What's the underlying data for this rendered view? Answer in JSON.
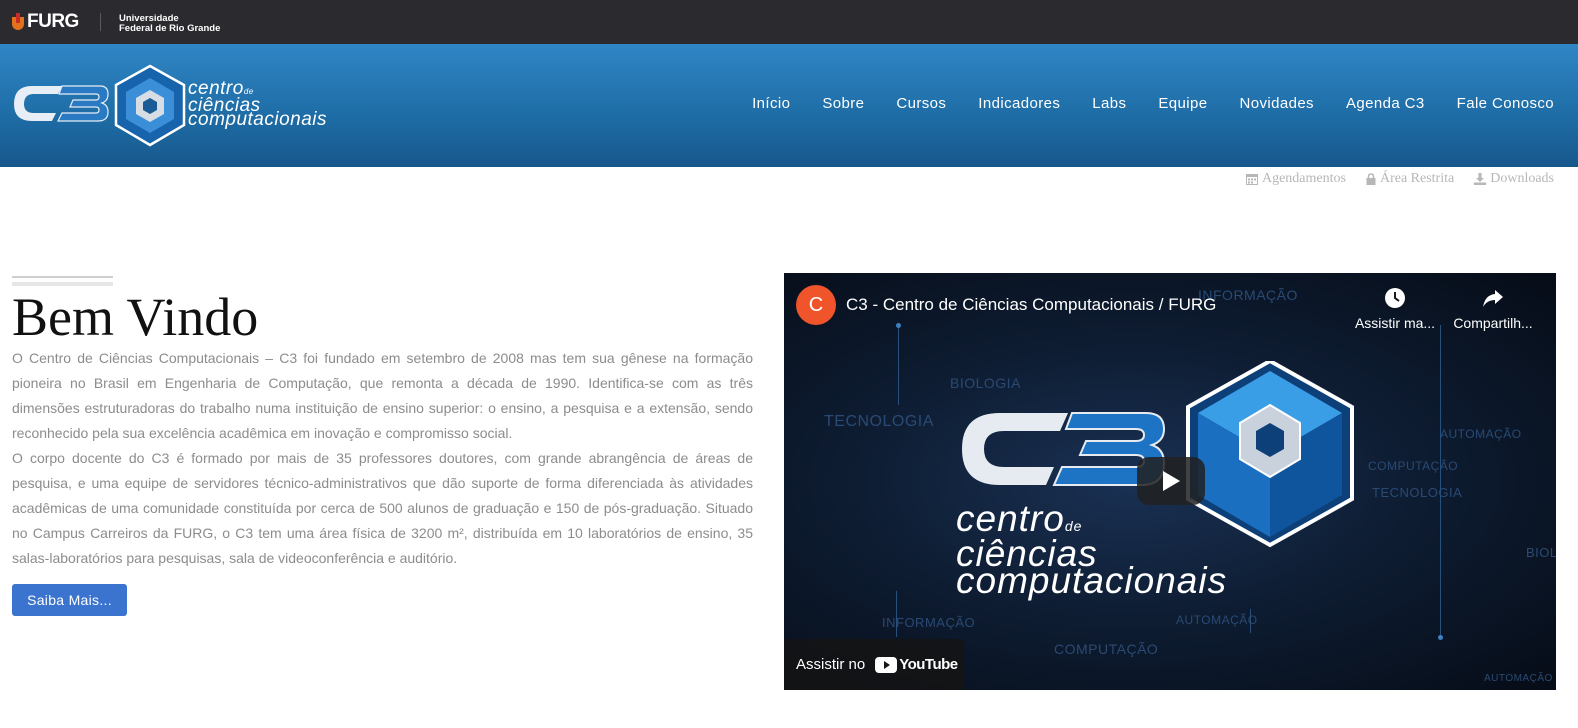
{
  "topbar": {
    "logo_text": "FURG",
    "university_line1": "Universidade",
    "university_line2": "Federal de Rio Grande"
  },
  "header": {
    "brand_logo_text": "C3",
    "brand_line1": "centro",
    "brand_de": "de",
    "brand_line2": "ciências",
    "brand_line3": "computacionais",
    "nav": [
      {
        "label": "Início"
      },
      {
        "label": "Sobre"
      },
      {
        "label": "Cursos"
      },
      {
        "label": "Indicadores"
      },
      {
        "label": "Labs"
      },
      {
        "label": "Equipe"
      },
      {
        "label": "Novidades"
      },
      {
        "label": "Agenda C3"
      },
      {
        "label": "Fale Conosco"
      }
    ]
  },
  "utility_links": [
    {
      "label": "Agendamentos",
      "icon": "calendar-icon"
    },
    {
      "label": "Área Restrita",
      "icon": "lock-icon"
    },
    {
      "label": "Downloads",
      "icon": "download-icon"
    }
  ],
  "welcome": {
    "title": "Bem Vindo",
    "paragraph1": "O Centro de Ciências Computacionais – C3 foi fundado em setembro de 2008 mas tem sua gênese na formação pioneira no Brasil em Engenharia de Computação, que remonta a década de 1990. Identifica-se com as três dimensões estruturadoras do trabalho numa instituição de ensino superior: o ensino, a pesquisa e a extensão, sendo reconhecido pela sua excelência acadêmica em inovação e compromisso social.",
    "paragraph2": "O corpo docente do C3 é formado por mais de 35 professores doutores, com grande abrangência de áreas de pesquisa, e uma equipe de servidores técnico-administrativos que dão suporte de forma diferenciada às atividades acadêmicas de uma comunidade constituída por cerca de 500 alunos de graduação e 150 de pós-graduação. Situado no Campus Carreiros da FURG, o C3 tem uma área física de 3200 m², distribuída em 10 laboratórios de ensino, 35 salas-laboratórios para pesquisas, sala de videoconferência e auditório.",
    "button_label": "Saiba Mais..."
  },
  "video": {
    "channel_initial": "C",
    "title": "C3 - Centro de Ciências Computacionais / FURG",
    "watch_later_label": "Assistir ma...",
    "share_label": "Compartilh...",
    "watch_on_label": "Assistir no",
    "youtube_label": "YouTube",
    "thumb_logo": "C3",
    "thumb_line1": "centro",
    "thumb_de": "de",
    "thumb_line2": "ciências",
    "thumb_line3": "computacionais",
    "bg_words": [
      "INFORMAÇÃO",
      "BIOLOGIA",
      "TECNOLOGIA",
      "AUTOMAÇÃO",
      "COMPUTAÇÃO",
      "TECNOLOGIA",
      "INFORMAÇÃO",
      "AUTOMAÇÃO",
      "COMPUTAÇÃO",
      "BIOL",
      "AUTOMAÇÃO"
    ]
  },
  "colors": {
    "topbar": "#2b2a2f",
    "header_blue": "#1f6ea8",
    "button_blue": "#3a74cf",
    "youtube_red": "#ff0000",
    "channel_avatar": "#f0542b"
  }
}
